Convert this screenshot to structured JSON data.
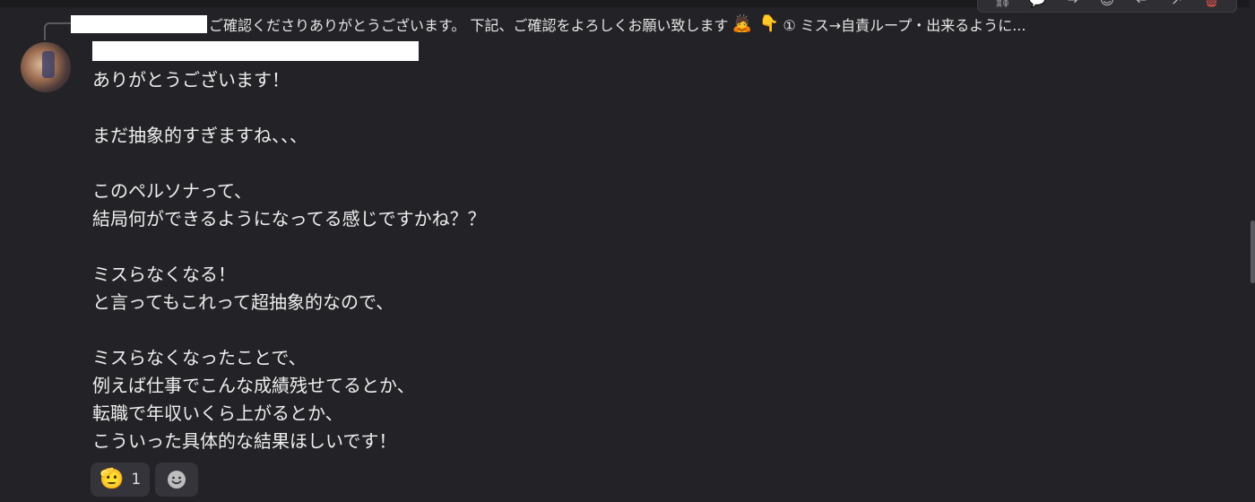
{
  "reply_preview": {
    "text_main": "ご確認くださりありがとうございます。 下記、ご確認をよろしくお願い致します",
    "emoji_1": "🙇",
    "emoji_2": "👇",
    "text_tail": " ① ミス→自責ループ・出来るように..."
  },
  "toolbar": {
    "icons": [
      "link-icon",
      "thread-icon",
      "forward-icon",
      "emoji-icon",
      "reply-icon",
      "share-icon",
      "delete-icon"
    ]
  },
  "message": {
    "lines": [
      "ありがとうございます！",
      "",
      "まだ抽象的すぎますね、、、",
      "",
      "このペルソナって、",
      "結局何ができるようになってる感じですかね？？",
      "",
      "ミスらなくなる！",
      "と言ってもこれって超抽象的なので、",
      "",
      "ミスらなくなったことで、",
      "例えば仕事でこんな成績残せてるとか、",
      "転職で年収いくら上がるとか、",
      "こういった具体的な結果ほしいです！"
    ]
  },
  "reactions": [
    {
      "emoji": "🫡",
      "count": "1"
    }
  ],
  "colors": {
    "background": "#232327",
    "text": "#eeeeee",
    "chip": "#34343a",
    "delete": "#e5534b"
  }
}
